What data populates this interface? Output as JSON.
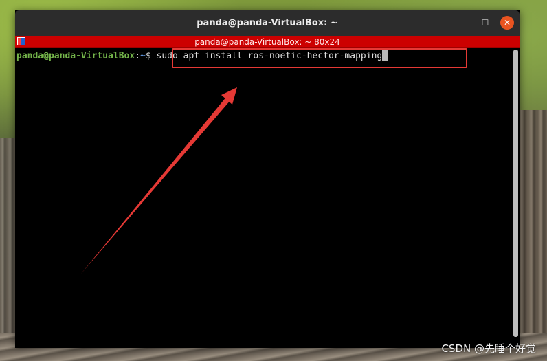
{
  "window": {
    "title": "panda@panda-VirtualBox: ~",
    "controls": {
      "minimize": "–",
      "maximize": "☐",
      "close": "✕"
    }
  },
  "tab": {
    "title": "panda@panda-VirtualBox: ~ 80x24"
  },
  "terminal": {
    "prompt_user": "panda@panda-VirtualBox",
    "prompt_sep": ":",
    "prompt_path": "~",
    "prompt_dollar": "$ ",
    "command": "sudo apt install ros-noetic-hector-mapping"
  },
  "annotation": {
    "box_color": "#e53935",
    "arrow_color": "#e53935"
  },
  "watermark": "CSDN @先睡个好觉"
}
